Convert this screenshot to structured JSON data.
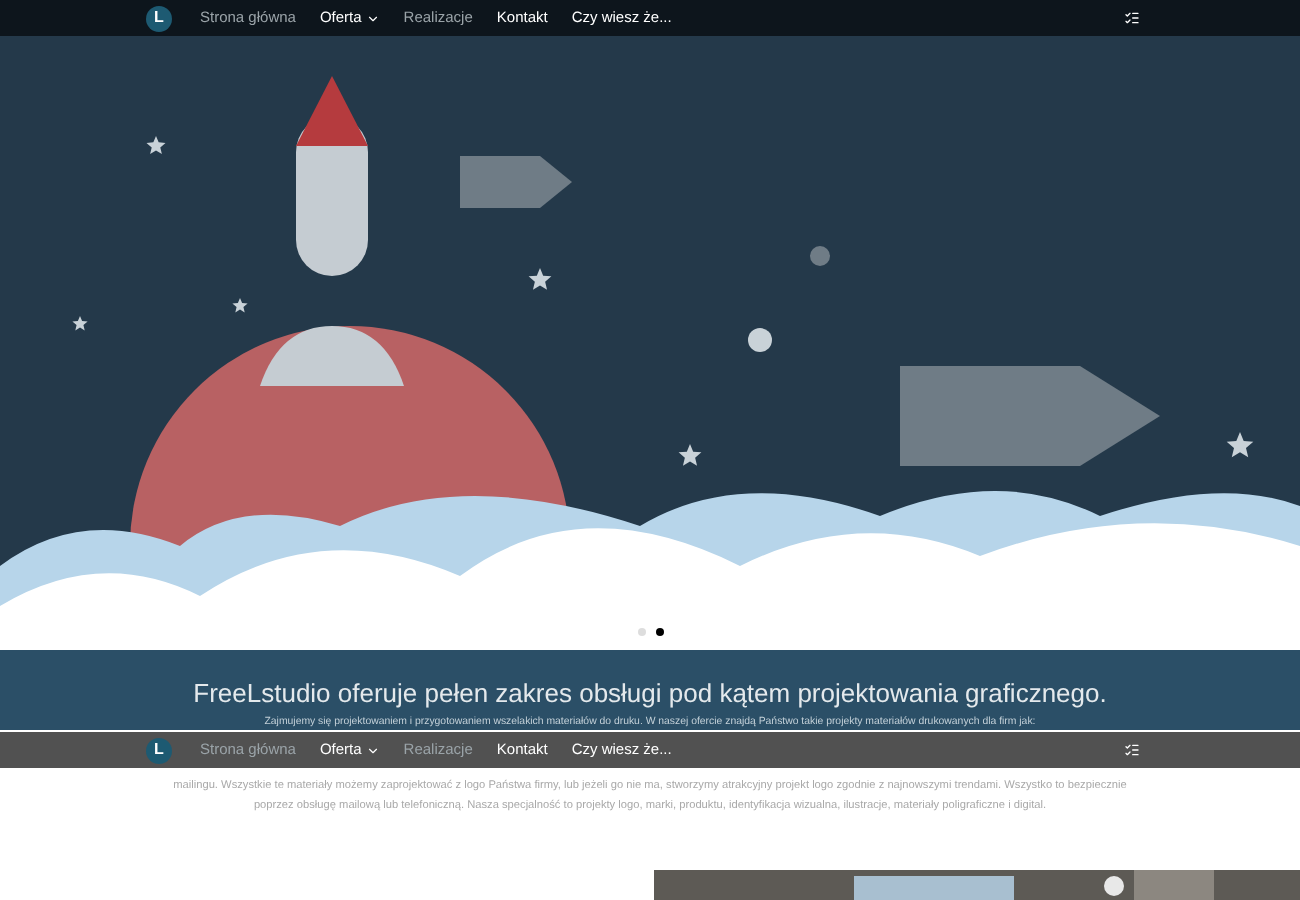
{
  "nav": {
    "logo": "L",
    "items": [
      {
        "label": "Strona główna",
        "dropdown": false,
        "dim": true
      },
      {
        "label": "Oferta",
        "dropdown": true,
        "dim": false
      },
      {
        "label": "Realizacje",
        "dim": true,
        "dropdown": false
      },
      {
        "label": "Kontakt",
        "dim": false,
        "dropdown": false
      },
      {
        "label": "Czy wiesz że...",
        "dim": false,
        "dropdown": false
      }
    ]
  },
  "hero": {
    "dots": [
      {
        "selected": false
      },
      {
        "selected": true
      }
    ]
  },
  "intro": {
    "heading": "FreeLstudio oferuje pełen zakres obsługi pod kątem projektowania graficznego.",
    "paragraph_top": "Zajmujemy się projektowaniem i przygotowaniem wszelakich materiałów do druku. W naszej ofercie znajdą Państwo takie projekty materiałów drukowanych dla firm jak:",
    "paragraph_bottom": "mailingu. Wszystkie te materiały możemy zaprojektować z logo Państwa firmy, lub jeżeli go nie ma, stworzymy atrakcyjny projekt logo zgodnie z najnowszymi trendami. Wszystko to bezpiecznie poprzez obsługę mailową lub telefoniczną. Nasza specjalność to projekty logo, marki, produktu, identyfikacja wizualna, ilustracje, materiały poligraficzne i digital."
  },
  "sticky_nav": {
    "logo": "L",
    "items": [
      {
        "label": "Strona główna",
        "dropdown": false,
        "dim": true
      },
      {
        "label": "Oferta",
        "dropdown": true,
        "dim": false
      },
      {
        "label": "Realizacje",
        "dim": true,
        "dropdown": false
      },
      {
        "label": "Kontakt",
        "dim": false,
        "dropdown": false
      },
      {
        "label": "Czy wiesz że...",
        "dim": false,
        "dropdown": false
      }
    ]
  }
}
